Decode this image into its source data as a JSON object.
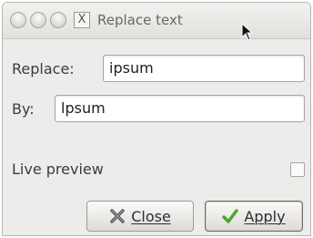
{
  "window": {
    "title": "Replace text"
  },
  "form": {
    "replace_label": "Replace:",
    "replace_value": "ipsum",
    "by_label": "By:",
    "by_value": "lpsum",
    "live_preview_label": "Live preview",
    "live_preview_checked": false
  },
  "buttons": {
    "close_label": "Close",
    "apply_label": "Apply"
  },
  "icons": {
    "window_buttons": [
      "window-close-icon",
      "window-minimize-icon",
      "window-maximize-icon"
    ],
    "app": "x-window-icon",
    "close": "close-x-icon",
    "apply": "checkmark-icon"
  },
  "colors": {
    "apply_check": "#4aa62a",
    "close_x": "#555555"
  }
}
